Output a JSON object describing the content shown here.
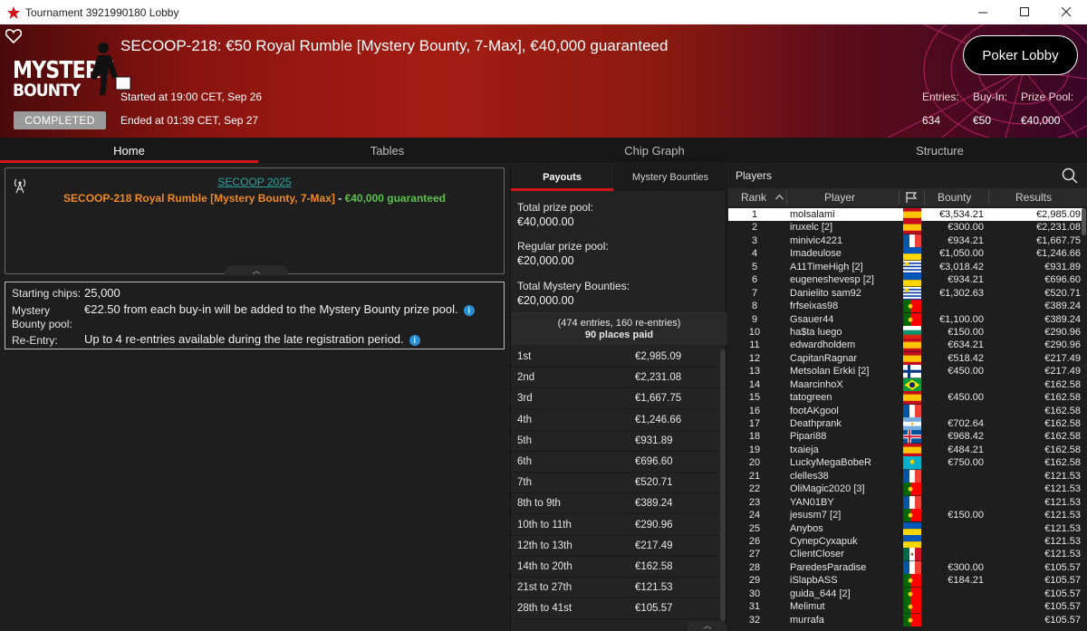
{
  "window": {
    "title": "Tournament 3921990180 Lobby"
  },
  "header": {
    "title": "SECOOP-218: €50 Royal Rumble [Mystery Bounty, 7-Max], €40,000 guaranteed",
    "logo_line1": "MYSTERY",
    "logo_line2": "BOUNTY",
    "started": "Started at 19:00 CET, Sep 26",
    "ended": "Ended at 01:39 CET, Sep 27",
    "status": "COMPLETED",
    "lobby_button": "Poker Lobby",
    "entries_label": "Entries:",
    "entries_value": "634",
    "buyin_label": "Buy-In:",
    "buyin_value": "€50",
    "prizepool_label": "Prize Pool:",
    "prizepool_value": "€40,000"
  },
  "tabs": [
    "Home",
    "Tables",
    "Chip Graph",
    "Structure"
  ],
  "info": {
    "series": "SECOOP 2025",
    "name_part1": "SECOOP-218 Royal Rumble [Mystery Bounty, 7-Max]",
    "name_sep": " - ",
    "name_part2": "€40,000 guaranteed"
  },
  "details": {
    "chips_label": "Starting chips:",
    "chips_value": "25,000",
    "mb_label_1": "Mystery",
    "mb_label_2": "Bounty pool:",
    "mb_value": "€22.50 from each buy-in will be added to the Mystery Bounty prize pool.",
    "reentry_label": "Re-Entry:",
    "reentry_value": "Up to 4 re-entries available during the late registration period."
  },
  "payouts": {
    "tab_payouts": "Payouts",
    "tab_bounties": "Mystery Bounties",
    "total_label": "Total prize pool:",
    "total_value": "€40,000.00",
    "regular_label": "Regular prize pool:",
    "regular_value": "€20,000.00",
    "mystery_label": "Total Mystery Bounties:",
    "mystery_value": "€20,000.00",
    "entries_line": "(474 entries, 160 re-entries)",
    "places_line": "90 places paid",
    "rows": [
      {
        "place": "1st",
        "amount": "€2,985.09"
      },
      {
        "place": "2nd",
        "amount": "€2,231.08"
      },
      {
        "place": "3rd",
        "amount": "€1,667.75"
      },
      {
        "place": "4th",
        "amount": "€1,246.66"
      },
      {
        "place": "5th",
        "amount": "€931.89"
      },
      {
        "place": "6th",
        "amount": "€696.60"
      },
      {
        "place": "7th",
        "amount": "€520.71"
      },
      {
        "place": "8th to 9th",
        "amount": "€389.24"
      },
      {
        "place": "10th to 11th",
        "amount": "€290.96"
      },
      {
        "place": "12th to 13th",
        "amount": "€217.49"
      },
      {
        "place": "14th to 20th",
        "amount": "€162.58"
      },
      {
        "place": "21st to 27th",
        "amount": "€121.53"
      },
      {
        "place": "28th to 41st",
        "amount": "€105.57"
      }
    ]
  },
  "players": {
    "title": "Players",
    "col_rank": "Rank",
    "col_player": "Player",
    "col_bounty": "Bounty",
    "col_results": "Results",
    "rows": [
      {
        "rank": "1",
        "name": "molsalami",
        "flag": "es",
        "bounty": "€3,534.21",
        "result": "€2,985.09"
      },
      {
        "rank": "2",
        "name": "iruxelc [2]",
        "flag": "es",
        "bounty": "€300.00",
        "result": "€2,231.08"
      },
      {
        "rank": "3",
        "name": "minivic4221",
        "flag": "fr",
        "bounty": "€934.21",
        "result": "€1,667.75"
      },
      {
        "rank": "4",
        "name": "Imadeulose",
        "flag": "ua",
        "bounty": "€1,050.00",
        "result": "€1,246.66"
      },
      {
        "rank": "5",
        "name": "A11TimeHigh [2]",
        "flag": "uy",
        "bounty": "€3,018.42",
        "result": "€931.89"
      },
      {
        "rank": "6",
        "name": "eugeneshevesp [2]",
        "flag": "ua",
        "bounty": "€934.21",
        "result": "€696.60"
      },
      {
        "rank": "7",
        "name": "Danielito sam92",
        "flag": "uy",
        "bounty": "€1,302.63",
        "result": "€520.71"
      },
      {
        "rank": "8",
        "name": "frfseixas98",
        "flag": "pt",
        "bounty": "",
        "result": "€389.24"
      },
      {
        "rank": "9",
        "name": "Gsauer44",
        "flag": "pt",
        "bounty": "€1,100.00",
        "result": "€389.24"
      },
      {
        "rank": "10",
        "name": "ha$ta luego",
        "flag": "bg",
        "bounty": "€150.00",
        "result": "€290.96"
      },
      {
        "rank": "11",
        "name": "edwardholdem",
        "flag": "es",
        "bounty": "€634.21",
        "result": "€290.96"
      },
      {
        "rank": "12",
        "name": "CapitanRagnar",
        "flag": "es",
        "bounty": "€518.42",
        "result": "€217.49"
      },
      {
        "rank": "13",
        "name": "Metsolan Erkki [2]",
        "flag": "fi",
        "bounty": "€450.00",
        "result": "€217.49"
      },
      {
        "rank": "14",
        "name": "MaarcinhoX",
        "flag": "br",
        "bounty": "",
        "result": "€162.58"
      },
      {
        "rank": "15",
        "name": "tatogreen",
        "flag": "es",
        "bounty": "€450.00",
        "result": "€162.58"
      },
      {
        "rank": "16",
        "name": "footAKgool",
        "flag": "fr",
        "bounty": "",
        "result": "€162.58"
      },
      {
        "rank": "17",
        "name": "Deathprank",
        "flag": "ar",
        "bounty": "€702.64",
        "result": "€162.58"
      },
      {
        "rank": "18",
        "name": "Pipari88",
        "flag": "is",
        "bounty": "€968.42",
        "result": "€162.58"
      },
      {
        "rank": "19",
        "name": "txaieja",
        "flag": "es",
        "bounty": "€484.21",
        "result": "€162.58"
      },
      {
        "rank": "20",
        "name": "LuckyMegaBobeR",
        "flag": "kz",
        "bounty": "€750.00",
        "result": "€162.58"
      },
      {
        "rank": "21",
        "name": "clelles38",
        "flag": "fr",
        "bounty": "",
        "result": "€121.53"
      },
      {
        "rank": "22",
        "name": "OliMagic2020 [3]",
        "flag": "pt",
        "bounty": "",
        "result": "€121.53"
      },
      {
        "rank": "23",
        "name": "YAN01BY",
        "flag": "fr",
        "bounty": "",
        "result": "€121.53"
      },
      {
        "rank": "24",
        "name": "jesusm7 [2]",
        "flag": "pt",
        "bounty": "€150.00",
        "result": "€121.53"
      },
      {
        "rank": "25",
        "name": "Anybos",
        "flag": "ua",
        "bounty": "",
        "result": "€121.53"
      },
      {
        "rank": "26",
        "name": "CynepCyxapuk",
        "flag": "ua",
        "bounty": "",
        "result": "€121.53"
      },
      {
        "rank": "27",
        "name": "ClientCloser",
        "flag": "mx",
        "bounty": "",
        "result": "€121.53"
      },
      {
        "rank": "28",
        "name": "ParedesParadise",
        "flag": "fr",
        "bounty": "€300.00",
        "result": "€105.57"
      },
      {
        "rank": "29",
        "name": "iSlapbASS",
        "flag": "pt",
        "bounty": "€184.21",
        "result": "€105.57"
      },
      {
        "rank": "30",
        "name": "guida_644 [2]",
        "flag": "pt",
        "bounty": "",
        "result": "€105.57"
      },
      {
        "rank": "31",
        "name": "Melimut",
        "flag": "pt",
        "bounty": "",
        "result": "€105.57"
      },
      {
        "rank": "32",
        "name": "murrafa",
        "flag": "pt",
        "bounty": "",
        "result": "€105.57"
      }
    ]
  },
  "colors": {
    "accent": "#d0161c",
    "link": "#2aa3a0",
    "orange": "#f1891f",
    "green": "#5cc04a"
  }
}
